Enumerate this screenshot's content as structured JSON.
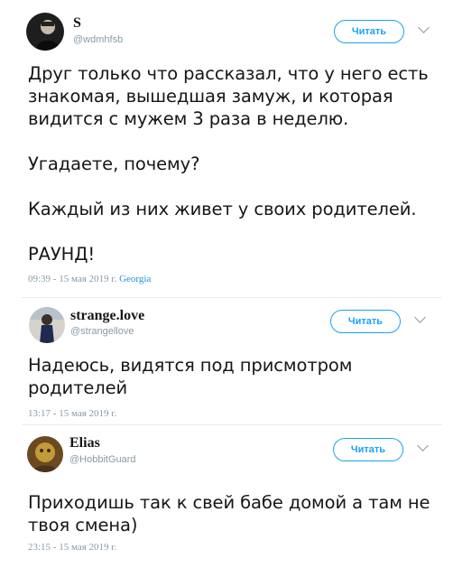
{
  "tweets": [
    {
      "name": "S",
      "handle": "@wdmhfsb",
      "follow_label": "Читать",
      "text": "Друг только что рассказал, что у него есть знакомая, вышедшая замуж, и которая видится с мужем 3 раза в неделю.\n\nУгадаете, почему?\n\nКаждый из них живет у своих родителей.\n\nРАУНД!",
      "timestamp": "09:39 - 15 мая 2019 г.",
      "location": "Georgia"
    },
    {
      "name": "strange.love",
      "handle": "@strangellove",
      "follow_label": "Читать",
      "text": "Надеюсь, видятся под присмотром родителей",
      "timestamp": "13:17 - 15 мая 2019 г."
    },
    {
      "name": "Elias",
      "handle": "@HobbitGuard",
      "follow_label": "Читать",
      "text": "Приходишь так к свей бабе домой а там не твоя смена)",
      "timestamp": "23:15 - 15 мая 2019 г."
    }
  ],
  "colors": {
    "accent": "#1da1f2",
    "meta_text": "#8a9aa6",
    "location_link": "#1b95e0"
  },
  "icons": [
    "chevron-down-icon"
  ]
}
